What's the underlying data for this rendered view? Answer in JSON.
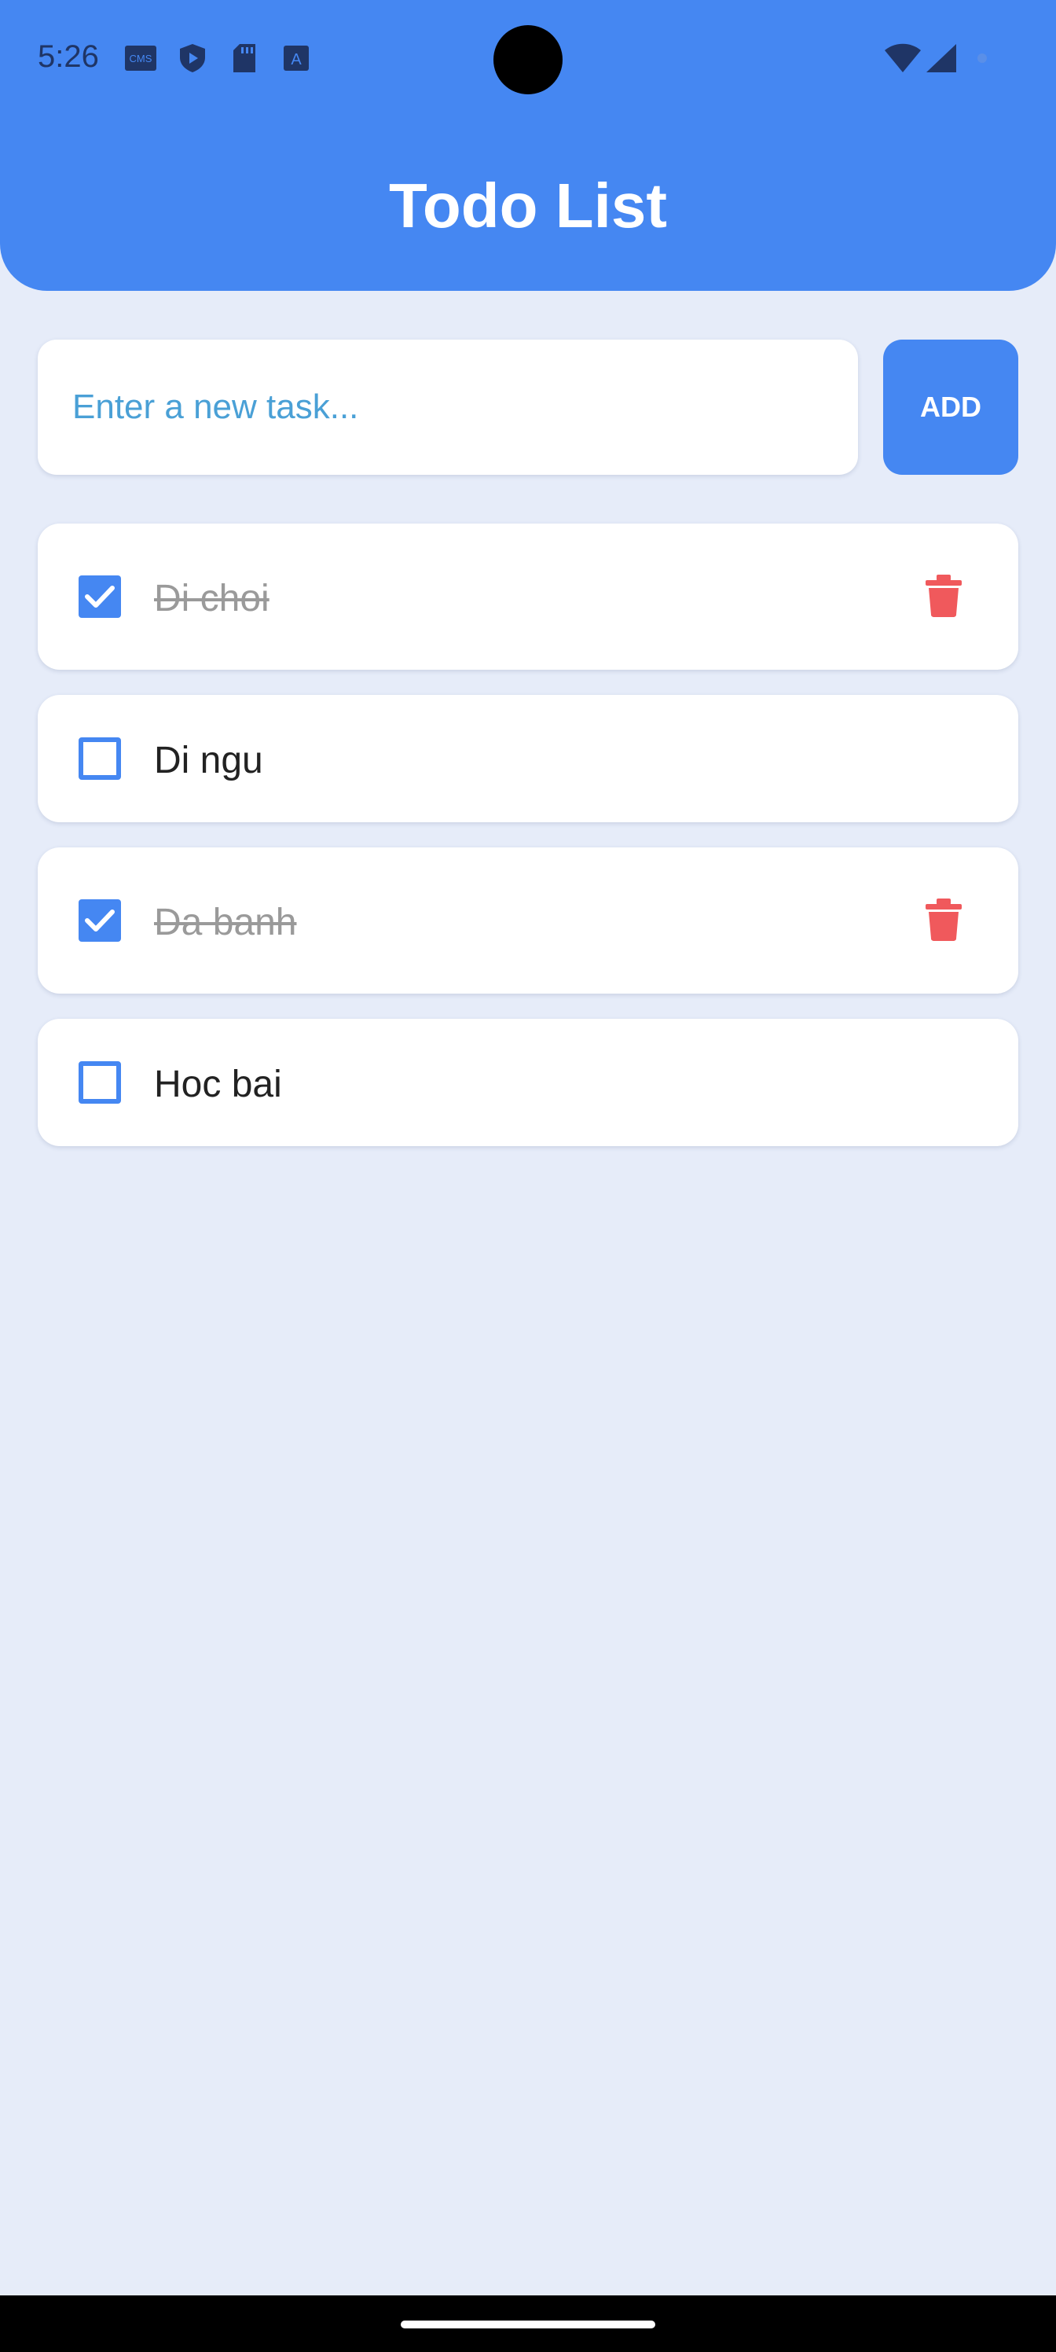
{
  "status_bar": {
    "time": "5:26",
    "icons": [
      "cms-icon",
      "shield-icon",
      "sd-card-icon",
      "a-icon",
      "wifi-icon",
      "signal-icon"
    ]
  },
  "header": {
    "title": "Todo List"
  },
  "new_task": {
    "placeholder": "Enter a new task...",
    "value": "",
    "add_label": "ADD"
  },
  "todos": [
    {
      "text": "Di choi",
      "done": true
    },
    {
      "text": "Di ngu",
      "done": false
    },
    {
      "text": "Da banh",
      "done": true
    },
    {
      "text": "Hoc bai",
      "done": false
    }
  ],
  "colors": {
    "accent": "#4587f2",
    "background": "#e6ecf9",
    "delete": "#f0595c",
    "placeholder": "#4aa0d6",
    "done_text": "#9a9a9a"
  }
}
